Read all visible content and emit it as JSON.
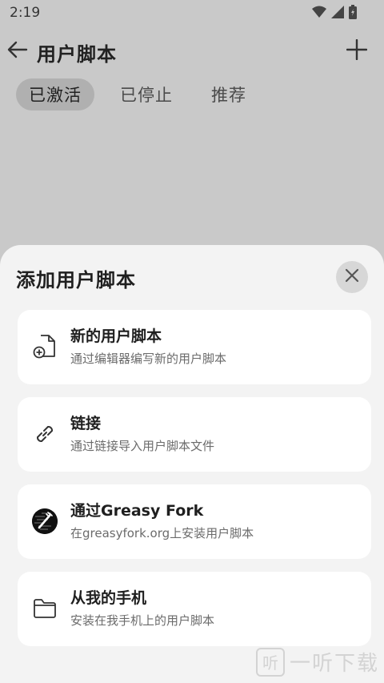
{
  "status_bar": {
    "time": "2:19"
  },
  "header": {
    "title": "用户脚本"
  },
  "tabs": [
    {
      "label": "已激活",
      "active": true
    },
    {
      "label": "已停止",
      "active": false
    },
    {
      "label": "推荐",
      "active": false
    }
  ],
  "sheet": {
    "title": "添加用户脚本",
    "options": [
      {
        "title": "新的用户脚本",
        "desc": "通过编辑器编写新的用户脚本",
        "icon": "new-file-icon"
      },
      {
        "title": "链接",
        "desc": "通过链接导入用户脚本文件",
        "icon": "link-icon"
      },
      {
        "title": "通过Greasy Fork",
        "desc": "在greasyfork.org上安装用户脚本",
        "icon": "greasyfork-logo-icon"
      },
      {
        "title": "从我的手机",
        "desc": "安装在我手机上的用户脚本",
        "icon": "folder-icon"
      }
    ]
  },
  "watermark": {
    "text": "一听下载",
    "badge": "听"
  },
  "colors": {
    "overlay": "#c9c9c9",
    "sheet_bg": "#f3f3f3",
    "card_bg": "#ffffff",
    "active_tab": "#b0b0b0"
  }
}
